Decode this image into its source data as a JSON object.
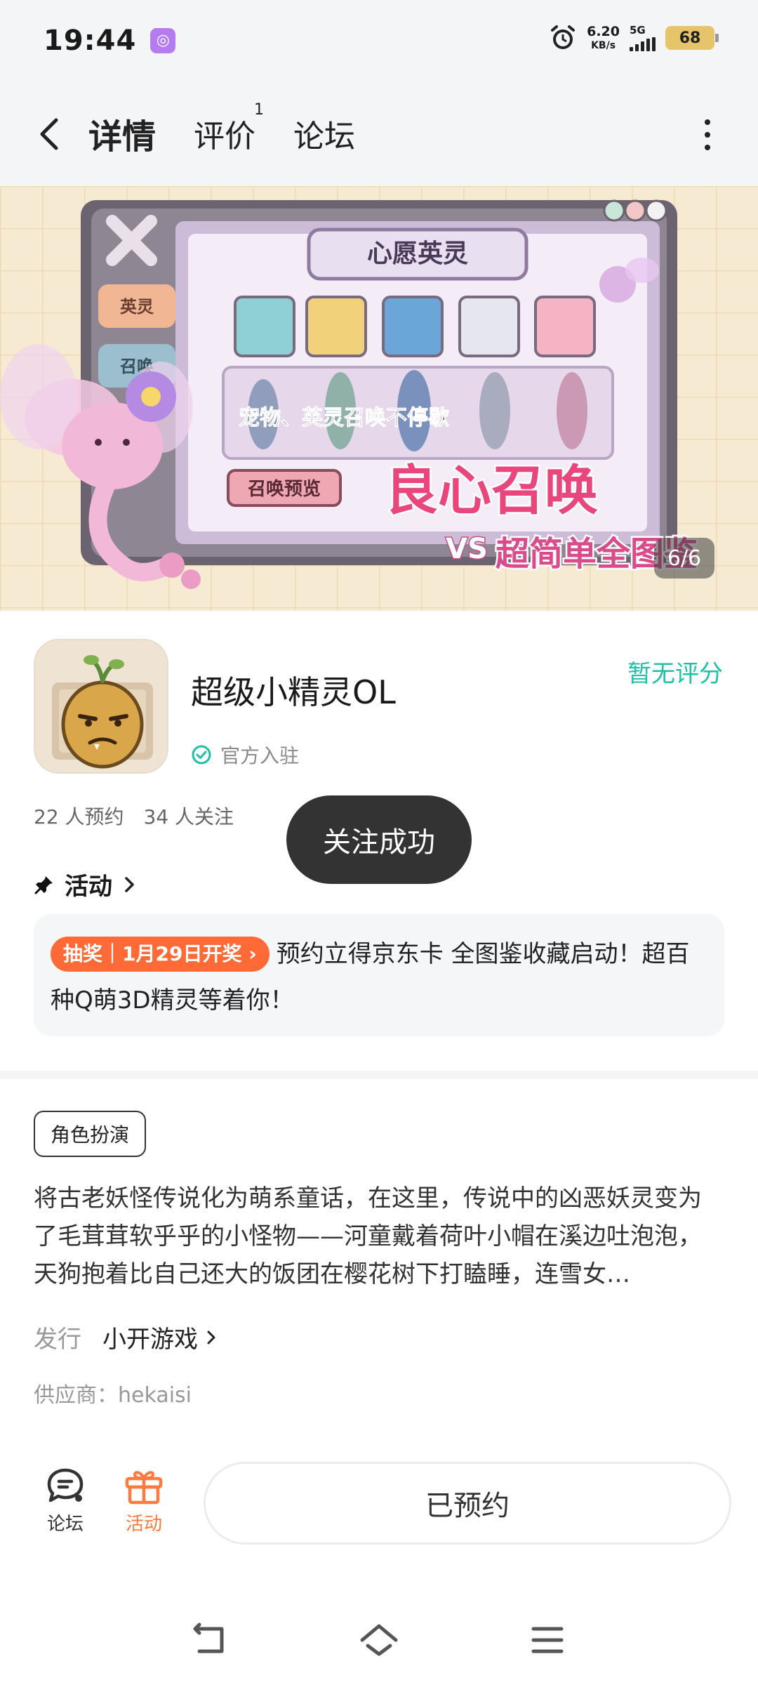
{
  "status_bar": {
    "time": "19:44",
    "net_speed_value": "6.20",
    "net_speed_unit": "KB/s",
    "network_type": "5G",
    "battery": "68"
  },
  "nav": {
    "tabs": [
      {
        "label": "详情",
        "active": true
      },
      {
        "label": "评价",
        "badge": "1"
      },
      {
        "label": "论坛"
      }
    ]
  },
  "banner": {
    "panel_title": "心愿英灵",
    "side_tabs": [
      "英灵",
      "召唤"
    ],
    "subtitle": "宠物、英灵召唤不停歇",
    "preview_button": "召唤预览",
    "headline": "良心召唤",
    "sub_headline": "超简单全图鉴",
    "counter": "6/6"
  },
  "app": {
    "name": "超级小精灵OL",
    "verified_label": "官方入驻",
    "rating": "暂无评分",
    "reservations": "22 人预约",
    "followers": "34 人关注"
  },
  "activity": {
    "header": "活动",
    "tag": "抽奖｜1月29日开奖",
    "text": "预约立得京东卡 全图鉴收藏启动！超百种Q萌3D精灵等着你！"
  },
  "toast": "关注成功",
  "details": {
    "genre": "角色扮演",
    "description": "将古老妖怪传说化为萌系童话，在这里，传说中的凶恶妖灵变为了毛茸茸软乎乎的小怪物——河童戴着荷叶小帽在溪边吐泡泡，天狗抱着比自己还大的饭团在樱花树下打瞌睡，连雪女…",
    "publisher_key": "发行",
    "publisher_value": "小开游戏",
    "supplier": "供应商：hekaisi"
  },
  "bottom_bar": {
    "forum_label": "论坛",
    "activity_label": "活动",
    "reserve_button": "已预约"
  },
  "colors": {
    "accent_teal": "#17d3bd",
    "rating_teal": "#1ec1a8",
    "promo_orange": "#ff6a37",
    "activity_orange": "#ff7a3d"
  }
}
